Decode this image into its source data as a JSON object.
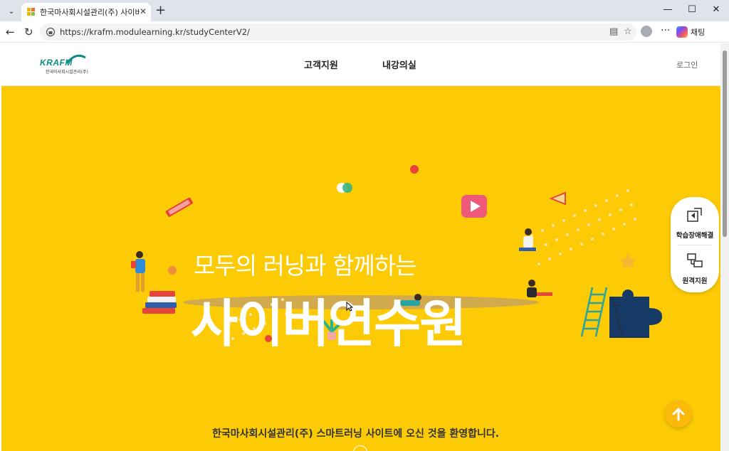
{
  "browser": {
    "tab_title": "한국마사회시설관리(주) 사이버 연",
    "tab_close": "✕",
    "new_tab": "+",
    "url": "https://krafm.modulearning.kr/studyCenterV2/",
    "copilot_label": "채팅",
    "window_controls": {
      "minimize": "—",
      "maximize": "☐",
      "close": "✕"
    }
  },
  "header": {
    "logo_text": "KRAFM",
    "logo_subtext": "한국마사회시설관리(주)",
    "nav": [
      {
        "label": "고객지원"
      },
      {
        "label": "내강의실"
      }
    ],
    "login_label": "로그인"
  },
  "hero": {
    "subtitle": "모두의 러닝과 함께하는",
    "title": "사이버연수원",
    "welcome": "한국마사회시설관리(주) 스마트러닝 사이트에 오신 것을 환영합니다.",
    "background_color": "#fdcb05"
  },
  "side_panel": {
    "items": [
      {
        "label": "학습장애해결",
        "icon": "troubleshoot-icon"
      },
      {
        "label": "원격지원",
        "icon": "remote-support-icon"
      }
    ]
  },
  "scroll_top": {
    "icon": "arrow-up-icon"
  }
}
